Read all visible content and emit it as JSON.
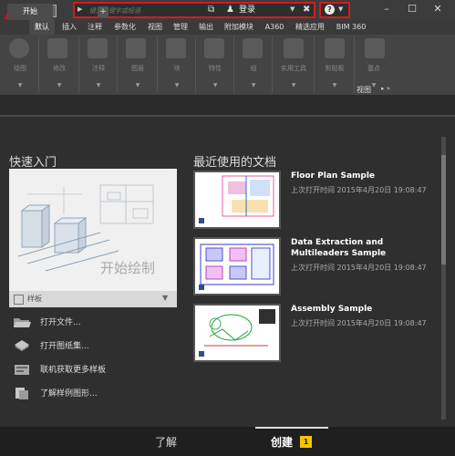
{
  "titlebar": {
    "search_placeholder": "键入关键字或短语",
    "login_label": "登录",
    "help_icon": "question-icon",
    "minimize": "–",
    "maximize": "☐",
    "close": "✕"
  },
  "ribbon_tabs": [
    {
      "label": "默认",
      "active": true
    },
    {
      "label": "插入"
    },
    {
      "label": "注释"
    },
    {
      "label": "参数化"
    },
    {
      "label": "视图"
    },
    {
      "label": "管理"
    },
    {
      "label": "输出"
    },
    {
      "label": "附加模块"
    },
    {
      "label": "A360"
    },
    {
      "label": "精选应用"
    },
    {
      "label": "BIM 360"
    }
  ],
  "ribbon_groups": [
    {
      "label": "绘图"
    },
    {
      "label": "修改"
    },
    {
      "label": "注释"
    },
    {
      "label": "图层"
    },
    {
      "label": "块"
    },
    {
      "label": "特性"
    },
    {
      "label": "组"
    },
    {
      "label": "实用工具"
    },
    {
      "label": "剪贴板"
    },
    {
      "label": "基点"
    }
  ],
  "ribbon_view_label": "视图",
  "doc_tabs": {
    "start": "开始",
    "add": "+"
  },
  "quick_start": {
    "heading": "快速入门",
    "card_text": "开始绘制",
    "template_label": "样板",
    "actions": [
      {
        "label": "打开文件...",
        "icon": "folder-icon"
      },
      {
        "label": "打开图纸集...",
        "icon": "sheetset-icon"
      },
      {
        "label": "联机获取更多样板",
        "icon": "online-templates-icon"
      },
      {
        "label": "了解样例图形...",
        "icon": "sample-drawings-icon"
      }
    ]
  },
  "recent": {
    "heading": "最近使用的文档",
    "documents": [
      {
        "name": "Floor Plan Sample",
        "time": "上次打开时间 2015年4月20日 19:08:47"
      },
      {
        "name": "Data Extraction and Multileaders Sample",
        "time": "上次打开时间 2015年4月20日 19:08:47"
      },
      {
        "name": "Assembly Sample",
        "time": "上次打开时间 2015年4月20日 19:08:47"
      }
    ]
  },
  "bottom": {
    "learn": "了解",
    "create": "创建",
    "badge": "1"
  },
  "colors": {
    "highlight_border": "#d51b1b",
    "brand_red": "#c8102e",
    "badge_yellow": "#f5c400"
  }
}
